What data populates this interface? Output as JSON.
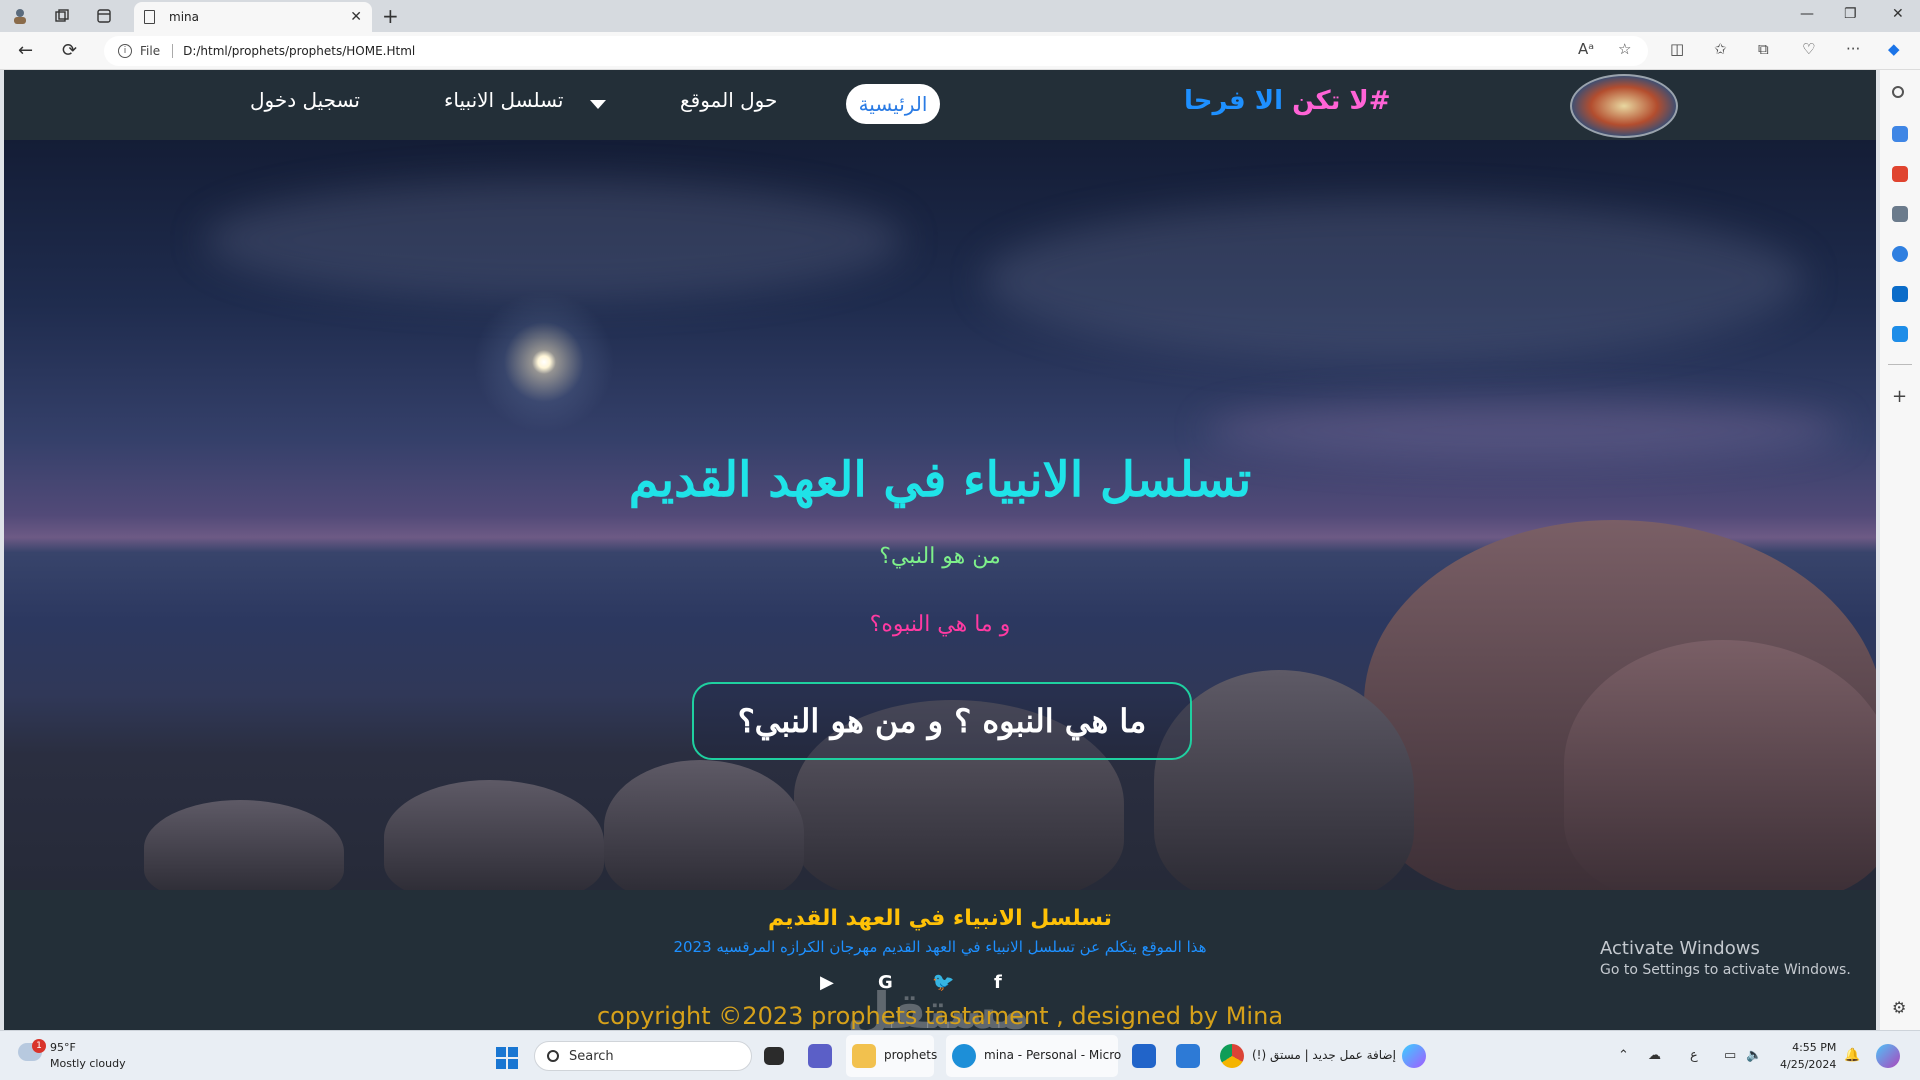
{
  "browser": {
    "tab_title": "mina",
    "address_protocol": "File",
    "address_url": "D:/html/prophets/prophets/HOME.Html"
  },
  "site": {
    "hashtag_part1": "#لا تكن",
    "hashtag_part2": " الا فرحا",
    "nav": {
      "home": "الرئيسية",
      "about": "حول الموقع",
      "prophets": "تسلسل الانبياء",
      "login": "تسجيل دخول"
    },
    "hero": {
      "title": "تسلسل الانبياء في العهد القديم",
      "question1": "من هو النبي؟",
      "question2": "و ما هي النبوه؟",
      "cta": "ما هي النبوه ؟ و من هو النبي؟"
    },
    "footer": {
      "title": "تسلسل الانبياء في العهد القديم",
      "description": "هذا الموقع يتكلم عن تسلسل الانبياء في العهد القديم مهرجان الكرازه المرقسيه 2023",
      "social": {
        "youtube": "▶",
        "google": "G",
        "twitter": "🐦",
        "facebook": "f"
      },
      "copyright": "copyright ©2023 prophets tastament , designed by Mina",
      "watermark": "مستقل"
    }
  },
  "windows": {
    "activate_title": "Activate Windows",
    "activate_sub": "Go to Settings to activate Windows."
  },
  "taskbar": {
    "weather_badge": "1",
    "weather_temp": "95°F",
    "weather_desc": "Mostly cloudy",
    "search_placeholder": "Search",
    "apps": {
      "explorer_label": "prophets",
      "edge_label": "mina - Personal - Micro",
      "chrome_label": "(!) إضافة عمل جديد | مستق"
    },
    "time": "4:55 PM",
    "date": "4/25/2024",
    "lang": "ع"
  },
  "colors": {
    "hero_title": "#1fe3e8",
    "question1": "#7ef08a",
    "question2": "#ff3aa2",
    "cta_border": "#1fd0a0",
    "footer_title": "#ffc107",
    "footer_desc": "#1e90ff",
    "copyright": "#d6a11a",
    "nav_bg": "#232f38"
  }
}
